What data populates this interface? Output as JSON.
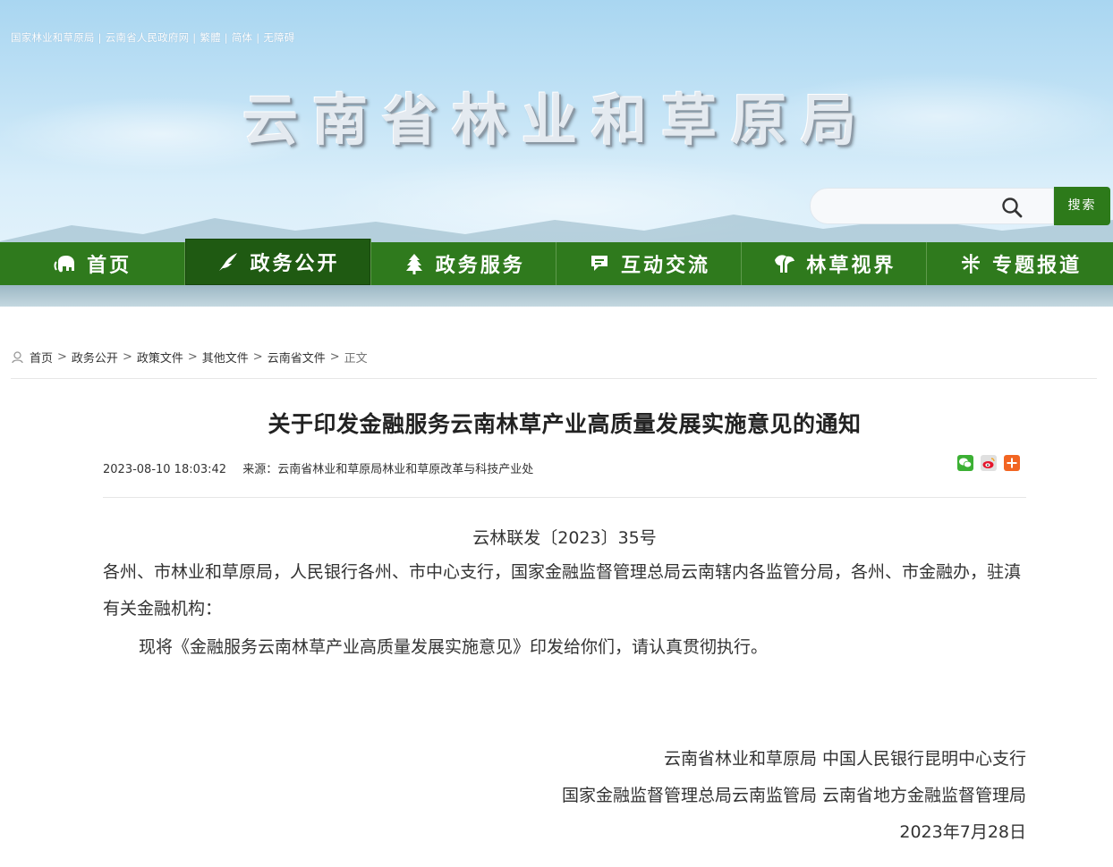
{
  "header": {
    "top_links": [
      "国家林业和草原局",
      "云南省人民政府网",
      "繁體",
      "简体",
      "无障碍"
    ],
    "site_title": "云南省林业和草原局",
    "search": {
      "placeholder": "",
      "button_label": "搜索"
    }
  },
  "nav": {
    "items": [
      {
        "label": "首页",
        "icon": "elephant-icon"
      },
      {
        "label": "政务公开",
        "icon": "bird-icon",
        "active": true
      },
      {
        "label": "政务服务",
        "icon": "tree-icon"
      },
      {
        "label": "互动交流",
        "icon": "chat-icon"
      },
      {
        "label": "林草视界",
        "icon": "peacock-icon"
      },
      {
        "label": "专题报道",
        "icon": "sprout-icon"
      }
    ]
  },
  "breadcrumb": {
    "items": [
      "首页",
      "政务公开",
      "政策文件",
      "其他文件",
      "云南省文件",
      "正文"
    ],
    "separator": ">"
  },
  "article": {
    "title": "关于印发金融服务云南林草产业高质量发展实施意见的通知",
    "datetime": "2023-08-10 18:03:42",
    "source_label": "来源：",
    "source": "云南省林业和草原局林业和草原改革与科技产业处",
    "share_icons": [
      "wechat-icon",
      "weibo-icon",
      "more-share-icon"
    ],
    "doc_number": "云林联发〔2023〕35号",
    "addressee": "各州、市林业和草原局，人民银行各州、市中心支行，国家金融监督管理总局云南辖内各监管分局，各州、市金融办，驻滇有关金融机构：",
    "body": "现将《金融服务云南林草产业高质量发展实施意见》印发给你们，请认真贯彻执行。",
    "signature_lines": [
      "云南省林业和草原局 中国人民银行昆明中心支行",
      "国家金融监督管理总局云南监管局 云南省地方金融监督管理局",
      "2023年7月28日"
    ]
  },
  "colors": {
    "nav_bg": "#2f7a1d",
    "nav_active_bg": "#1f5a12",
    "search_button": "#2d7a1a",
    "wechat": "#3cb034",
    "weibo": "#e0e0e0",
    "more_share": "#f26522"
  }
}
